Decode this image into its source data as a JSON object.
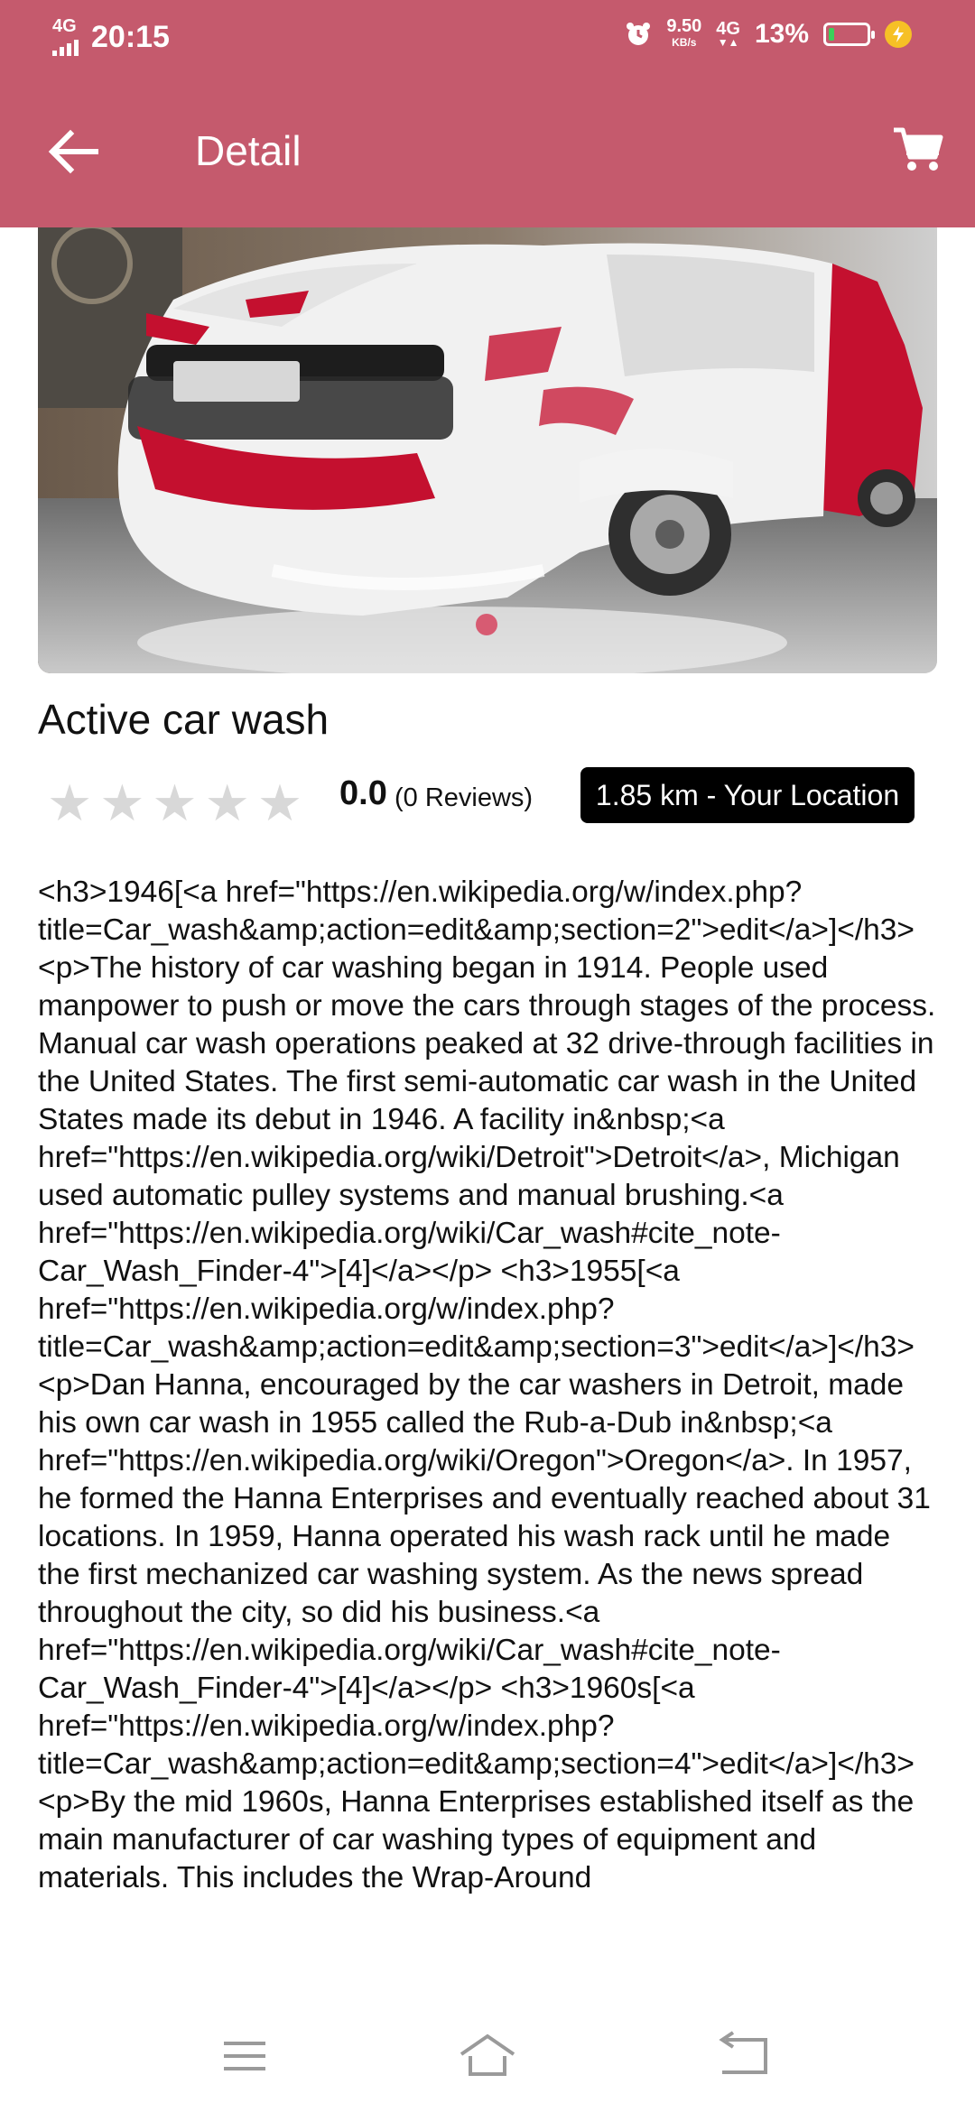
{
  "status": {
    "network_left": "4G",
    "time": "20:15",
    "speed": "9.50",
    "speed_unit": "KB/s",
    "network_right": "4G",
    "battery": "13%"
  },
  "toolbar": {
    "title": "Detail",
    "back_icon": "arrow-left-icon",
    "cart_icon": "cart-icon"
  },
  "item": {
    "name": "Active car wash",
    "stars": [
      "★",
      "★",
      "★",
      "★",
      "★"
    ],
    "rating_fraction": 0,
    "rating": "0.0",
    "reviews": "(0 Reviews)",
    "distance": "1.85 km - Your Location",
    "description": "<h3>1946[<a href=\"https://en.wikipedia.org/w/index.php?title=Car_wash&amp;action=edit&amp;section=2\">edit</a>]</h3> <p>The history of car washing began in 1914. People used manpower to push or move the cars through stages of the process. Manual car wash operations peaked at 32 drive-through facilities in the United States. The first semi-automatic car wash in the United States made its debut in 1946. A facility in&nbsp;<a href=\"https://en.wikipedia.org/wiki/Detroit\">Detroit</a>, Michigan used automatic pulley systems and manual brushing.<a href=\"https://en.wikipedia.org/wiki/Car_wash#cite_note-Car_Wash_Finder-4\">[4]</a></p> <h3>1955[<a href=\"https://en.wikipedia.org/w/index.php?title=Car_wash&amp;action=edit&amp;section=3\">edit</a>]</h3> <p>Dan Hanna, encouraged by the car washers in Detroit, made his own car wash in 1955 called the Rub-a-Dub in&nbsp;<a href=\"https://en.wikipedia.org/wiki/Oregon\">Oregon</a>. In 1957, he formed the Hanna Enterprises and eventually reached about 31 locations. In 1959, Hanna operated his wash rack until he made the first mechanized car washing system. As the news spread throughout the city, so did his business.<a href=\"https://en.wikipedia.org/wiki/Car_wash#cite_note-Car_Wash_Finder-4\">[4]</a></p> <h3>1960s[<a href=\"https://en.wikipedia.org/w/index.php?title=Car_wash&amp;action=edit&amp;section=4\">edit</a>]</h3> <p>By the mid 1960s, Hanna Enterprises established itself as the main manufacturer of car washing types of equipment and materials. This includes the Wrap-Around"
  },
  "colors": {
    "appbar": "#c55a6d",
    "dot": "#d75b72",
    "badge_bg": "#000000"
  },
  "navbar": {
    "menu_icon": "menu-icon",
    "home_icon": "home-icon",
    "back_icon": "back-icon"
  }
}
